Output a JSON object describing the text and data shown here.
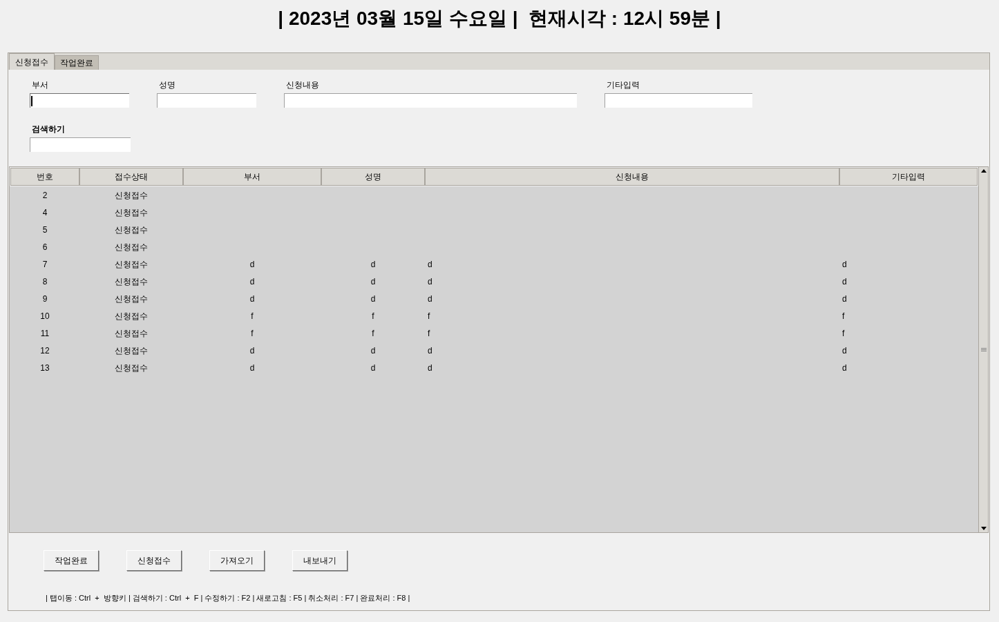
{
  "header": {
    "title": "| 2023년 03월 15일 수요일 |  현재시각 : 12시 59분 |"
  },
  "tabs": [
    {
      "label": "신청접수",
      "selected": true
    },
    {
      "label": "작업완료",
      "selected": false
    }
  ],
  "fields": [
    {
      "label": "부서",
      "focused": true
    },
    {
      "label": "성명",
      "focused": false
    },
    {
      "label": "신청내용",
      "focused": false
    },
    {
      "label": "기타입력",
      "focused": false
    }
  ],
  "search": {
    "label": "검색하기"
  },
  "table": {
    "columns": [
      "번호",
      "접수상태",
      "부서",
      "성명",
      "신청내용",
      "기타입력"
    ],
    "rows": [
      [
        "2",
        "신청접수"
      ],
      [
        "4",
        "신청접수"
      ],
      [
        "5",
        "신청접수"
      ],
      [
        "6",
        "신청접수"
      ],
      [
        "7",
        "신청접수",
        "d",
        "d",
        "d",
        "d"
      ],
      [
        "8",
        "신청접수",
        "d",
        "d",
        "d",
        "d"
      ],
      [
        "9",
        "신청접수",
        "d",
        "d",
        "d",
        "d"
      ],
      [
        "10",
        "신청접수",
        "f",
        "f",
        "f",
        "f"
      ],
      [
        "11",
        "신청접수",
        "f",
        "f",
        "f",
        "f"
      ],
      [
        "12",
        "신청접수",
        "d",
        "d",
        "d",
        "d"
      ],
      [
        "13",
        "신청접수",
        "d",
        "d",
        "d",
        "d"
      ]
    ]
  },
  "buttons": [
    "작업완료",
    "신청접수",
    "가져오기",
    "내보내기"
  ],
  "shortcuts": "| 탭이동 : Ctrl  +  방향키 | 검색하기 : Ctrl  +  F | 수정하기 : F2 | 새로고침 : F5 | 취소처리 : F7 | 완료처리 : F8 |"
}
